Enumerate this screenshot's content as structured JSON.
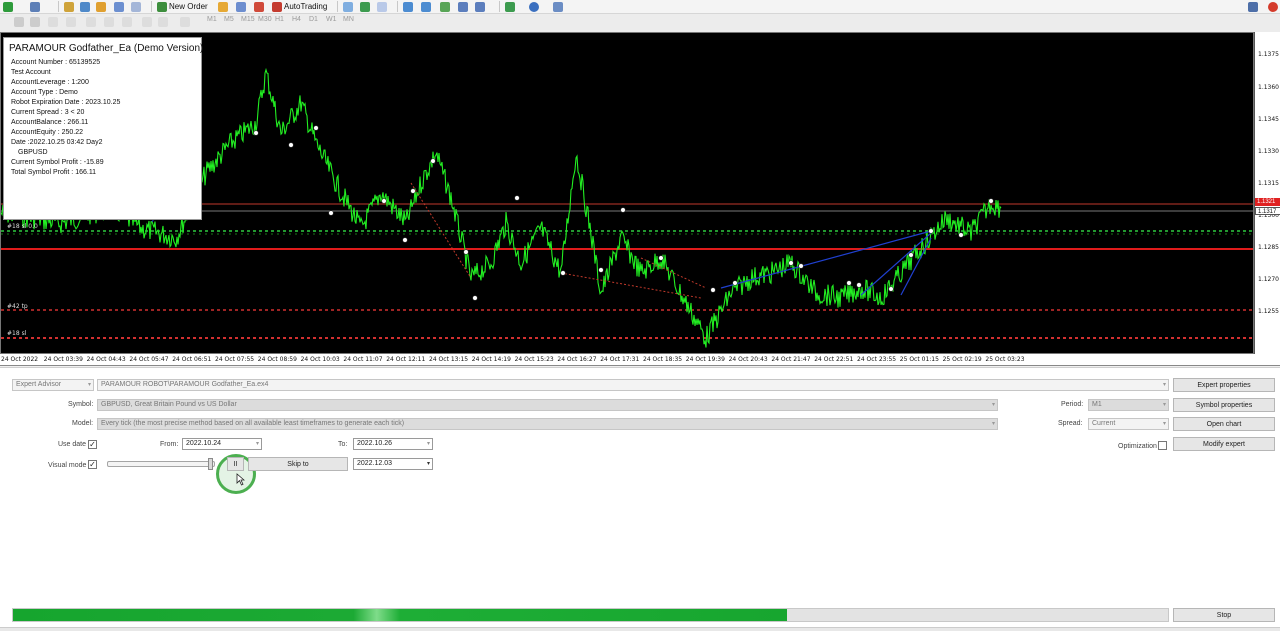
{
  "toolbar": {
    "new_order_label": "New Order",
    "autotrading_label": "AutoTrading",
    "timeframes": [
      "M1",
      "M5",
      "M15",
      "M30",
      "H1",
      "H4",
      "D1",
      "W1",
      "MN"
    ],
    "icons": [
      "new-chart-icon",
      "profiles-icon",
      "crosshair-icon",
      "move-icon",
      "zoom-icon",
      "line-icon",
      "text-icon",
      "zoom-in-icon",
      "zoom-out-icon",
      "grid-icon",
      "indicators-icon",
      "clock-icon",
      "templates-icon"
    ]
  },
  "info_panel": {
    "title": "PARAMOUR Godfather_Ea (Demo Version)",
    "lines": [
      "Account Number : 65139525",
      "Test Account",
      "AccountLeverage : 1:200",
      "Account Type : Demo",
      "Robot Expiration Date : 2023.10.25",
      "Current Spread : 3 < 20",
      "AccountBalance : 266.11",
      "AccountEquity : 250.22",
      "Date :2022.10.25 03:42 Day2",
      "GBPUSD",
      "Current Symbol Profit : -15.89",
      "Total Symbol Profit : 166.11"
    ]
  },
  "chart": {
    "line_color": "#00ff00",
    "background": "#000000",
    "order_labels": [
      "#18 sl 0.0",
      "#42 tp",
      "#18 sl"
    ],
    "price_ticks": [
      "1.1375",
      "1.1360",
      "1.1345",
      "1.1330",
      "1.1315",
      "1.1300",
      "1.1285",
      "1.1270",
      "1.1255"
    ],
    "price_tag_red": "1.1321",
    "price_tag_white": "1.1317",
    "time_labels": [
      "24 Oct 2022",
      "24 Oct 03:39",
      "24 Oct 04:43",
      "24 Oct 05:47",
      "24 Oct 06:51",
      "24 Oct 07:55",
      "24 Oct 08:59",
      "24 Oct 10:03",
      "24 Oct 11:07",
      "24 Oct 12:11",
      "24 Oct 13:15",
      "24 Oct 14:19",
      "24 Oct 15:23",
      "24 Oct 16:27",
      "24 Oct 17:31",
      "24 Oct 18:35",
      "24 Oct 19:39",
      "24 Oct 20:43",
      "24 Oct 21:47",
      "24 Oct 22:51",
      "24 Oct 23:55",
      "25 Oct 01:15",
      "25 Oct 02:19",
      "25 Oct 03:23"
    ]
  },
  "tester": {
    "ea_type": "Expert Advisor",
    "ea_path": "PARAMOUR ROBOT\\PARAMOUR Godfather_Ea.ex4",
    "symbol_label": "Symbol:",
    "symbol_value": "GBPUSD, Great Britain Pound vs US Dollar",
    "model_label": "Model:",
    "model_value": "Every tick (the most precise method based on all available least timeframes to generate each tick)",
    "use_date_label": "Use date",
    "use_date_checked": "✓",
    "from_label": "From:",
    "from_value": "2022.10.24",
    "to_label": "To:",
    "to_value": "2022.10.26",
    "visual_mode_label": "Visual mode",
    "visual_mode_checked": "✓",
    "visual_speed_fraction": 0.97,
    "pause_label": "II",
    "skip_to_label": "Skip to",
    "skip_to_date": "2022.12.03",
    "period_label": "Period:",
    "period_value": "M1",
    "spread_label": "Spread:",
    "spread_value": "Current",
    "optimization_label": "Optimization",
    "expert_properties_label": "Expert properties",
    "symbol_properties_label": "Symbol properties",
    "open_chart_label": "Open chart",
    "modify_expert_label": "Modify expert",
    "stop_label": "Stop",
    "progress_fraction": 0.67
  }
}
